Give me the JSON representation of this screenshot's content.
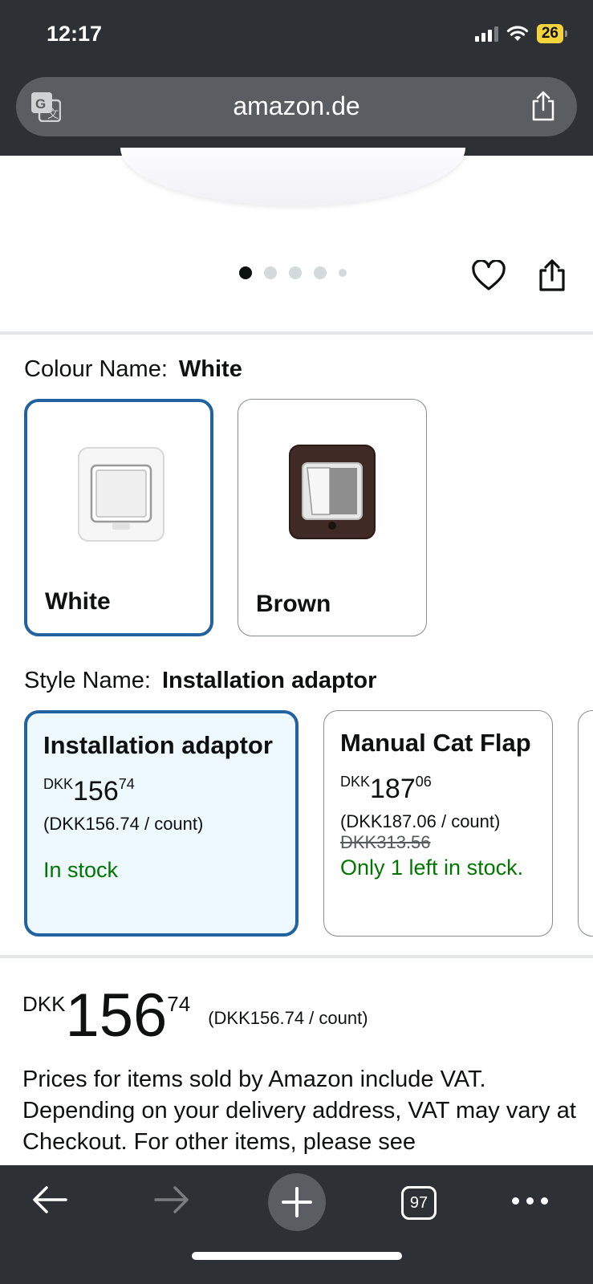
{
  "status_bar": {
    "time": "12:17",
    "battery": "26"
  },
  "browser": {
    "url": "amazon.de",
    "tab_count": "97"
  },
  "gallery": {
    "dot_count": 5,
    "active_dot": 0
  },
  "colour": {
    "label": "Colour Name:",
    "selected": "White",
    "options": [
      {
        "label": "White",
        "selected": true
      },
      {
        "label": "Brown",
        "selected": false
      }
    ]
  },
  "style": {
    "label": "Style Name:",
    "selected": "Installation adaptor",
    "options": [
      {
        "title": "Installation adaptor",
        "currency": "DKK",
        "whole": "156",
        "fraction": "74",
        "per_count": "(DKK156.74 / count)",
        "list_price": "",
        "stock": "In stock",
        "selected": true
      },
      {
        "title": "Manual Cat Flap",
        "currency": "DKK",
        "whole": "187",
        "fraction": "06",
        "per_count": "(DKK187.06 / count)",
        "list_price": "DKK313.56",
        "stock": "Only 1 left in stock.",
        "selected": false
      }
    ]
  },
  "price": {
    "currency": "DKK",
    "whole": "156",
    "fraction": "74",
    "per_count": "(DKK156.74 / count)"
  },
  "vat_note": "Prices for items sold by Amazon include VAT. Depending on your delivery address, VAT may vary at Checkout. For other items, please see",
  "colors": {
    "accent": "#2162a1",
    "stock_green": "#007600",
    "chrome": "#2d3034"
  }
}
